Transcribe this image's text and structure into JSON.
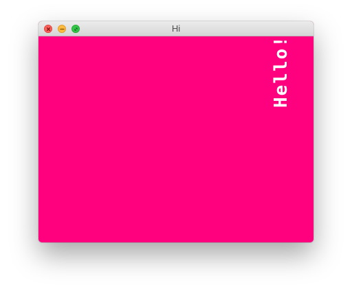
{
  "window": {
    "title": "Hi",
    "background_color": "#ff007f"
  },
  "titlebar": {
    "buttons": [
      {
        "name": "close",
        "icon": "close-icon",
        "color": "#fc605b"
      },
      {
        "name": "minimize",
        "icon": "minimize-icon",
        "color": "#fdbc40"
      },
      {
        "name": "maximize",
        "icon": "fullscreen-icon",
        "color": "#34c84a"
      }
    ]
  },
  "content": {
    "message": "Hello!",
    "text_color": "#ffffff"
  }
}
